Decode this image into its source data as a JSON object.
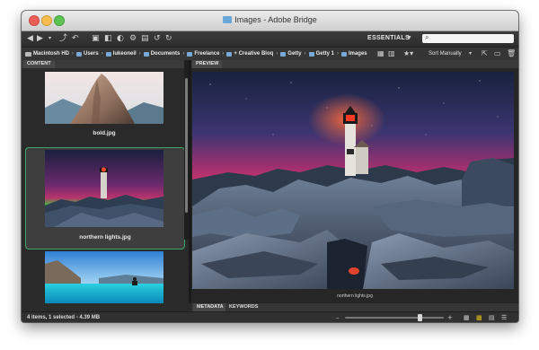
{
  "window": {
    "title": "Images - Adobe Bridge"
  },
  "toolbar": {
    "workspace": "ESSENTIALS",
    "search_placeholder": ""
  },
  "path": {
    "crumbs": [
      "Macintosh HD",
      "Users",
      "lukeoneil",
      "Documents",
      "Freelance",
      "+ Creative Bloq",
      "Getty",
      "Getty 1",
      "Images"
    ],
    "sort_label": "Sort Manually"
  },
  "content_panel": {
    "tab": "CONTENT",
    "items": [
      {
        "label": "bold.jpg",
        "selected": false
      },
      {
        "label": "northern lights.jpg",
        "selected": true
      },
      {
        "label": "",
        "selected": false
      }
    ]
  },
  "preview_panel": {
    "tab": "PREVIEW",
    "caption": "northern lights.jpg"
  },
  "metadata_tabs": [
    "METADATA",
    "KEYWORDS"
  ],
  "status": {
    "text": "4 items, 1 selected - 4.39 MB",
    "zoom_fraction": 0.75
  },
  "colors": {
    "selection_border": "#3fa36a",
    "panel_bg": "#2a2a2a"
  }
}
